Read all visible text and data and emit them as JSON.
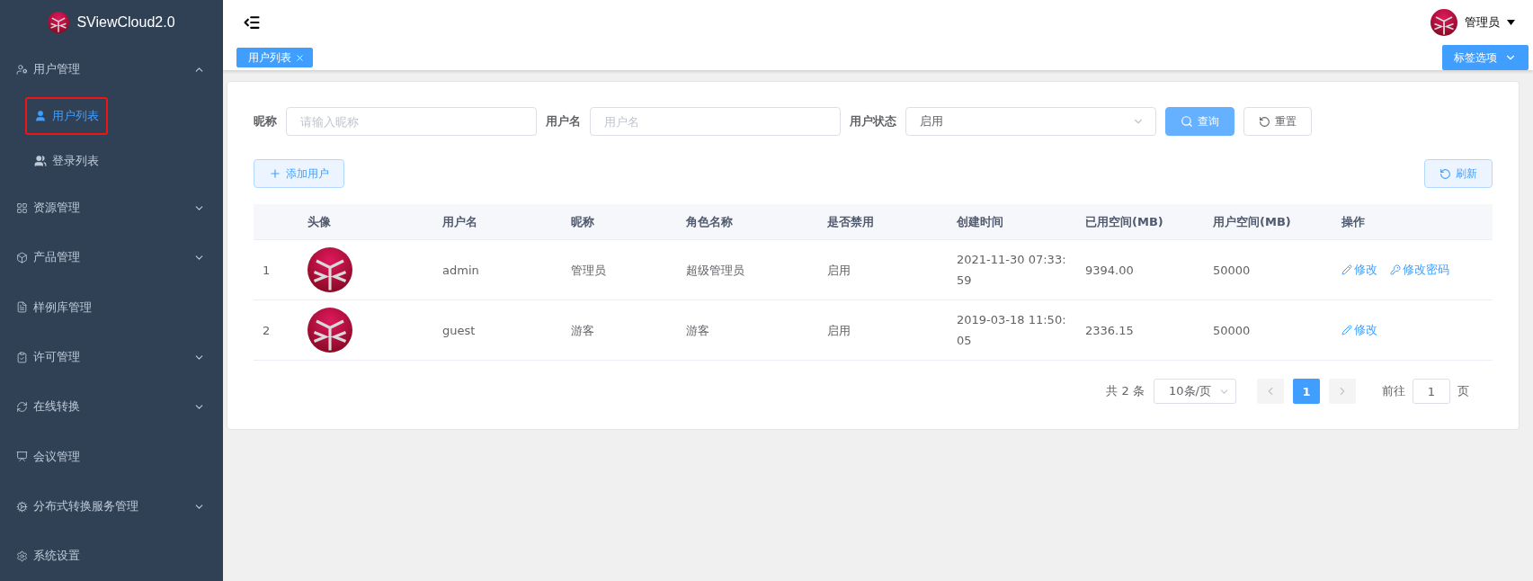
{
  "brand": {
    "name": "SViewCloud2.0"
  },
  "sidebar": {
    "items": [
      {
        "kind": "group",
        "label": "用户管理",
        "expanded": true,
        "children": [
          {
            "label": "用户列表",
            "selected": true
          },
          {
            "label": "登录列表",
            "selected": false
          }
        ]
      },
      {
        "kind": "group",
        "label": "资源管理",
        "expanded": false
      },
      {
        "kind": "group",
        "label": "产品管理",
        "expanded": false
      },
      {
        "kind": "link",
        "label": "样例库管理",
        "selected": false
      },
      {
        "kind": "group",
        "label": "许可管理",
        "expanded": false
      },
      {
        "kind": "group",
        "label": "在线转换",
        "expanded": false
      },
      {
        "kind": "link",
        "label": "会议管理",
        "selected": false
      },
      {
        "kind": "group",
        "label": "分布式转换服务管理",
        "expanded": false
      },
      {
        "kind": "link",
        "label": "系统设置",
        "selected": false
      }
    ]
  },
  "header": {
    "user": "管理员"
  },
  "tabs": [
    {
      "label": "用户列表",
      "selected": true
    }
  ],
  "tab_options": "标签选项",
  "filters": [
    {
      "kind": "input",
      "label": "昵称",
      "placeholder": "请输入昵称"
    },
    {
      "kind": "input",
      "label": "用户名",
      "placeholder": "用户名"
    },
    {
      "kind": "select",
      "label": "用户状态",
      "value": "启用"
    }
  ],
  "search_button": "查询",
  "reset_button": "重置",
  "add_button": "添加用户",
  "refresh_button": "刷新",
  "table": {
    "columns": [
      "",
      "头像",
      "用户名",
      "昵称",
      "角色名称",
      "是否禁用",
      "创建时间",
      "已用空间(MB)",
      "用户空间(MB)",
      "操作"
    ],
    "rows": [
      {
        "index": "1",
        "username": "admin",
        "nickname": "管理员",
        "role": "超级管理员",
        "status": "启用",
        "created": "2021-11-30 07:33:59",
        "used": "9394.00",
        "quota": "50000",
        "actions": [
          {
            "kind": "edit",
            "label": "修改"
          },
          {
            "kind": "password",
            "label": "修改密码"
          }
        ]
      },
      {
        "index": "2",
        "username": "guest",
        "nickname": "游客",
        "role": "游客",
        "status": "启用",
        "created": "2019-03-18 11:50:05",
        "used": "2336.15",
        "quota": "50000",
        "actions": [
          {
            "kind": "edit",
            "label": "修改"
          }
        ]
      }
    ]
  },
  "pagination": {
    "total": "共 2 条",
    "page_size": "10条/页",
    "pages": [
      {
        "label": "1",
        "selected": true
      }
    ],
    "goto_label": "前往",
    "goto_value": "1",
    "page_suffix": "页"
  }
}
